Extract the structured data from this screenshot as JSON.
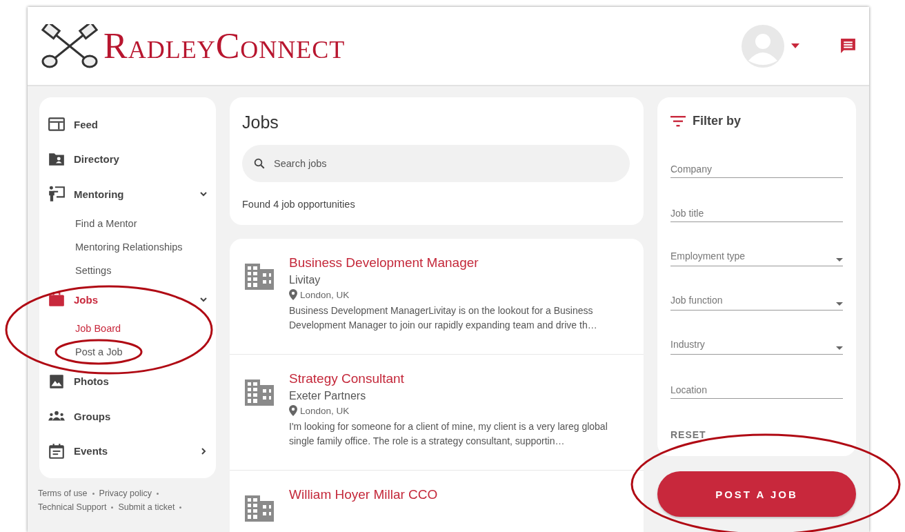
{
  "header": {
    "logo_text": "RadleyConnect"
  },
  "sidebar": {
    "items": [
      {
        "label": "Feed",
        "selected": false
      },
      {
        "label": "Directory",
        "selected": false
      },
      {
        "label": "Mentoring",
        "selected": false,
        "expanded": true,
        "children": [
          {
            "label": "Find a Mentor",
            "selected": false
          },
          {
            "label": "Mentoring Relationships",
            "selected": false
          },
          {
            "label": "Settings",
            "selected": false
          }
        ]
      },
      {
        "label": "Jobs",
        "selected": true,
        "expanded": true,
        "children": [
          {
            "label": "Job Board",
            "selected": true
          },
          {
            "label": "Post a Job",
            "selected": false
          }
        ]
      },
      {
        "label": "Photos",
        "selected": false
      },
      {
        "label": "Groups",
        "selected": false
      },
      {
        "label": "Events",
        "selected": false,
        "expanded": false
      }
    ],
    "footer_links": [
      "Terms of use",
      "Privacy policy",
      "Technical Support",
      "Submit a ticket"
    ]
  },
  "jobs": {
    "title": "Jobs",
    "search": {
      "placeholder": "Search jobs"
    },
    "result_count": "Found 4 job opportunities",
    "listings": [
      {
        "title": "Business Development Manager",
        "company": "Livitay",
        "location": "London, UK",
        "description": "Business Development ManagerLivitay is on the lookout for a Business Development Manager to join our rapidly expanding team and drive th…"
      },
      {
        "title": "Strategy Consultant",
        "company": "Exeter Partners",
        "location": "London, UK",
        "description": "I'm looking for someone for a client of mine, my client is a very lareg global single family office. The role is a strategy consultant, supportin…"
      },
      {
        "title": "William Hoyer Millar CCO"
      }
    ]
  },
  "filter": {
    "title": "Filter by",
    "fields": [
      {
        "placeholder": "Company",
        "kind": "text"
      },
      {
        "placeholder": "Job title",
        "kind": "text"
      },
      {
        "label": "Employment type",
        "kind": "select"
      },
      {
        "label": "Job function",
        "kind": "select"
      },
      {
        "label": "Industry",
        "kind": "select"
      },
      {
        "placeholder": "Location",
        "kind": "text"
      }
    ],
    "reset": "RESET"
  },
  "post_button": "POST A JOB"
}
